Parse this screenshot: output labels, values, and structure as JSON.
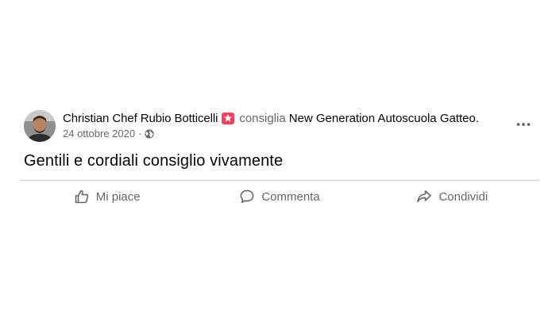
{
  "post": {
    "author": "Christian Chef Rubio Botticelli",
    "verb": "consiglia",
    "target": "New Generation Autoscuola Gatteo.",
    "date": "24 ottobre 2020",
    "separator": "·",
    "text": "Gentili e cordiali consiglio vivamente",
    "icons": {
      "recommend": "star-badge-icon",
      "privacy": "globe-icon",
      "more": "more-options-icon"
    },
    "colors": {
      "badge": "#f3425f",
      "secondary_text": "#65676b",
      "primary_text": "#050505",
      "divider": "#ced0d4"
    }
  },
  "actions": {
    "like": "Mi piace",
    "comment": "Commenta",
    "share": "Condividi"
  }
}
